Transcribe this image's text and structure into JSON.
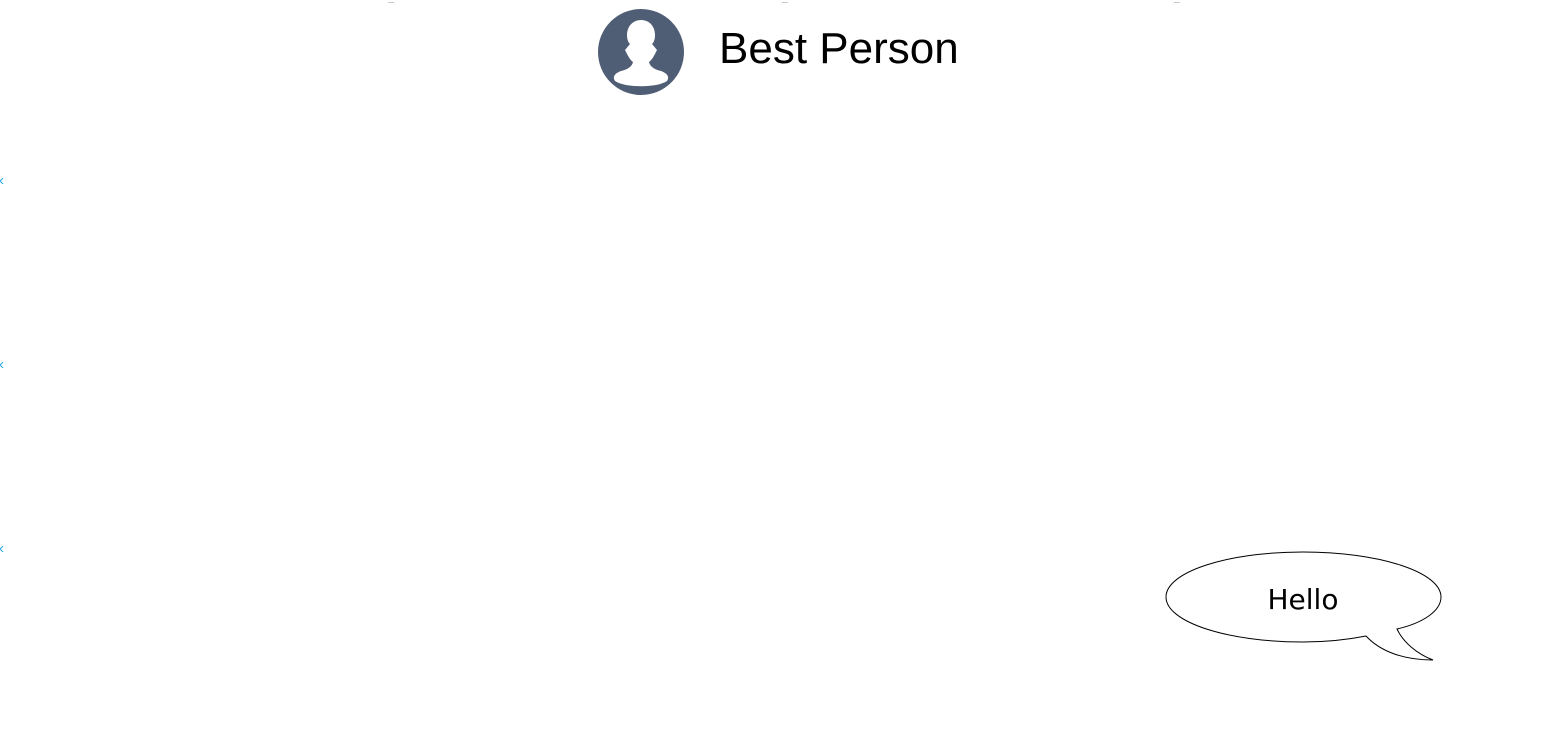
{
  "header": {
    "contact_name": "Best Person",
    "avatar_icon": "user-avatar-icon",
    "avatar_color": "#4f5d75"
  },
  "messages": [
    {
      "text": "Hello",
      "style": "speech-bubble"
    }
  ],
  "colors": {
    "marker_accent": "#29a8e0"
  }
}
